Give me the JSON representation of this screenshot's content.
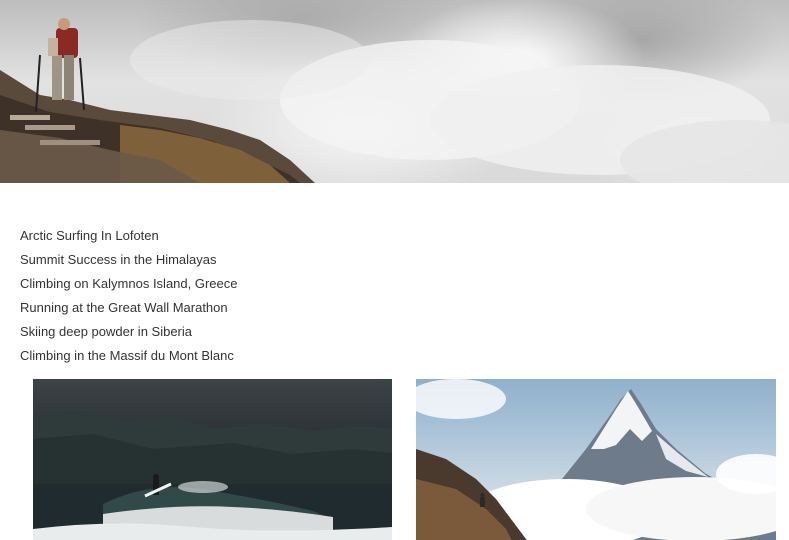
{
  "trips": [
    {
      "label": "Arctic Surfing In Lofoten"
    },
    {
      "label": "Summit Success in the Himalayas"
    },
    {
      "label": "Climbing on Kalymnos Island, Greece"
    },
    {
      "label": "Running at the Great Wall Marathon"
    },
    {
      "label": "Skiing deep powder in Siberia"
    },
    {
      "label": "Climbing in the Massif du Mont Blanc"
    }
  ],
  "images": {
    "hero": "hiker-on-mountain-ridge-above-clouds",
    "thumb_left": "surfer-on-wave-under-dark-sky",
    "thumb_right": "hiker-below-snowy-himalayan-peak"
  }
}
